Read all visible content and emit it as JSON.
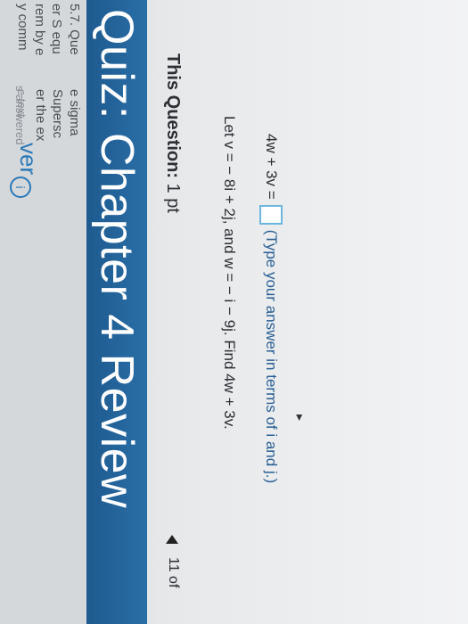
{
  "header": {
    "title": "Quiz: Chapter 4 Review"
  },
  "question_meta": {
    "label": "This Question:",
    "points": "1 pt"
  },
  "nav": {
    "page": "11 of"
  },
  "question": {
    "text": "Let v = − 8i + 2j, and w = − i − 9j. Find 4w + 3v."
  },
  "answer": {
    "lhs": "4w + 3v =",
    "hint": "(Type your answer in terms of i and j.)"
  },
  "left_panel": {
    "q_number": "5.7. Que",
    "lines": [
      "er S equ",
      "rem by e",
      "y comm"
    ],
    "v_lines": [
      "e sigma",
      "Supersc",
      "er the ex"
    ],
    "small_1": "e text",
    "answer_header": "ver",
    "small_2": "s answered"
  }
}
